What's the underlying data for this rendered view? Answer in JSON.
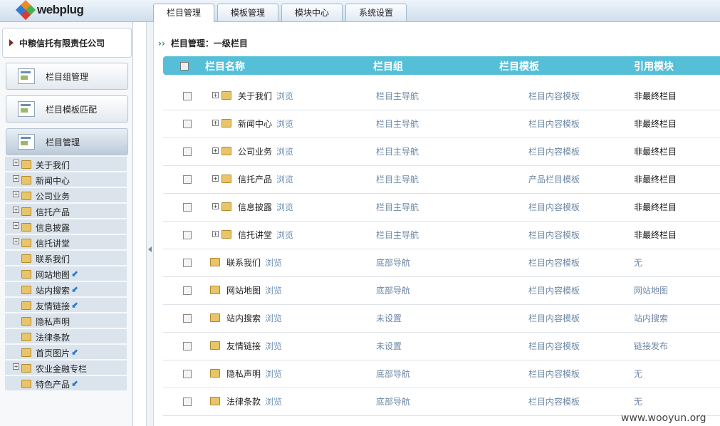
{
  "app": {
    "logo_text": "webplug"
  },
  "tabs": [
    "栏目管理",
    "模板管理",
    "模块中心",
    "系统设置"
  ],
  "sidebar": {
    "company": "中粮信托有限责任公司",
    "buttons": [
      "栏目组管理",
      "栏目模板匹配",
      "栏目管理"
    ],
    "tree": [
      {
        "label": "关于我们",
        "expandable": true,
        "link": false
      },
      {
        "label": "新闻中心",
        "expandable": true,
        "link": false
      },
      {
        "label": "公司业务",
        "expandable": true,
        "link": false
      },
      {
        "label": "信托产品",
        "expandable": true,
        "link": false
      },
      {
        "label": "信息披露",
        "expandable": true,
        "link": false
      },
      {
        "label": "信托讲堂",
        "expandable": true,
        "link": false
      },
      {
        "label": "联系我们",
        "expandable": false,
        "link": false
      },
      {
        "label": "网站地图",
        "expandable": false,
        "link": true
      },
      {
        "label": "站内搜索",
        "expandable": false,
        "link": true
      },
      {
        "label": "友情链接",
        "expandable": false,
        "link": true
      },
      {
        "label": "隐私声明",
        "expandable": false,
        "link": false
      },
      {
        "label": "法律条款",
        "expandable": false,
        "link": false
      },
      {
        "label": "首页图片",
        "expandable": false,
        "link": true
      },
      {
        "label": "农业金融专栏",
        "expandable": true,
        "link": false
      },
      {
        "label": "特色产品",
        "expandable": false,
        "link": true
      }
    ]
  },
  "main": {
    "breadcrumb": "栏目管理：一级栏目",
    "breadcrumb_marker": "››",
    "columns": [
      "栏目名称",
      "栏目组",
      "栏目模板",
      "引用模块"
    ],
    "browse_label": "浏览",
    "rows": [
      {
        "name": "关于我们",
        "expandable": true,
        "group": "栏目主导航",
        "template": "栏目内容模板",
        "module": "非最终栏目"
      },
      {
        "name": "新闻中心",
        "expandable": true,
        "group": "栏目主导航",
        "template": "栏目内容模板",
        "module": "非最终栏目"
      },
      {
        "name": "公司业务",
        "expandable": true,
        "group": "栏目主导航",
        "template": "栏目内容模板",
        "module": "非最终栏目"
      },
      {
        "name": "信托产品",
        "expandable": true,
        "group": "栏目主导航",
        "template": "产品栏目模板",
        "module": "非最终栏目"
      },
      {
        "name": "信息披露",
        "expandable": true,
        "group": "栏目主导航",
        "template": "栏目内容模板",
        "module": "非最终栏目"
      },
      {
        "name": "信托讲堂",
        "expandable": true,
        "group": "栏目主导航",
        "template": "栏目内容模板",
        "module": "非最终栏目"
      },
      {
        "name": "联系我们",
        "expandable": false,
        "group": "底部导航",
        "template": "栏目内容模板",
        "module": "无"
      },
      {
        "name": "网站地图",
        "expandable": false,
        "group": "底部导航",
        "template": "栏目内容模板",
        "module": "网站地图"
      },
      {
        "name": "站内搜索",
        "expandable": false,
        "group": "未设置",
        "template": "栏目内容模板",
        "module": "站内搜索"
      },
      {
        "name": "友情链接",
        "expandable": false,
        "group": "未设置",
        "template": "栏目内容模板",
        "module": "链接发布"
      },
      {
        "name": "隐私声明",
        "expandable": false,
        "group": "底部导航",
        "template": "栏目内容模板",
        "module": "无"
      },
      {
        "name": "法律条款",
        "expandable": false,
        "group": "底部导航",
        "template": "栏目内容模板",
        "module": "无"
      }
    ]
  },
  "watermark": "www.wooyun.org",
  "colors": {
    "header_bar": "#55bfd8",
    "link": "#6c8fb5",
    "folder": "#e8c46a"
  }
}
